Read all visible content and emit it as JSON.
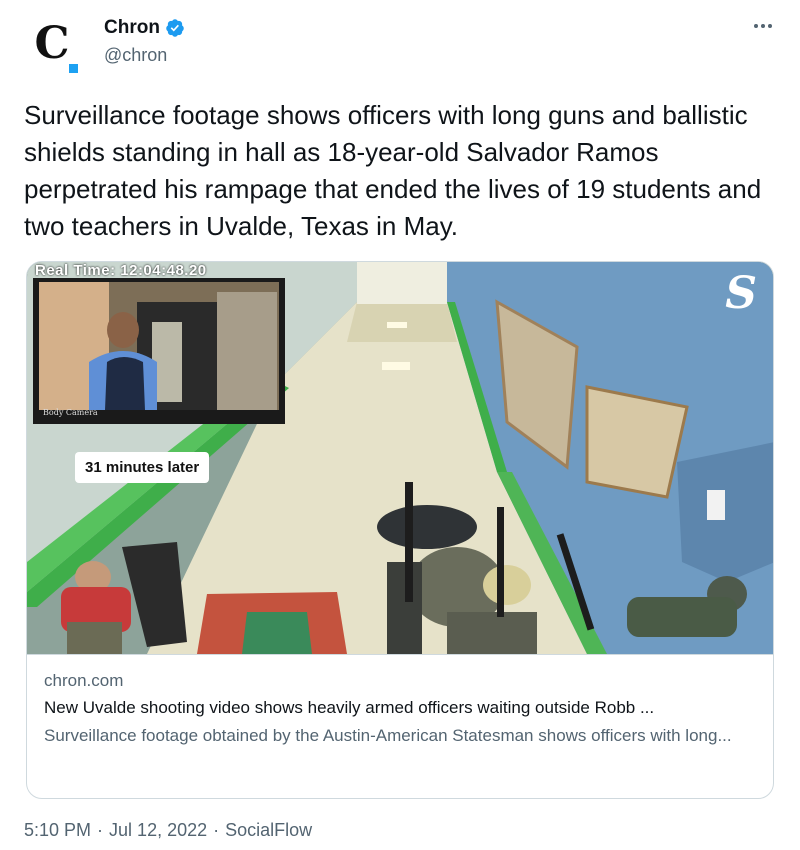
{
  "author": {
    "display_name": "Chron",
    "handle": "@chron",
    "avatar_logo": "C",
    "verified": true
  },
  "tweet": {
    "text": "Surveillance footage shows officers with long guns and ballistic shields standing in hall as 18-year-old Salvador Ramos perpetrated his rampage that ended the lives of 19 students and two teachers in Uvalde, Texas in May."
  },
  "card": {
    "media": {
      "overlay_time": "Real Time: 12:04:48.20",
      "caption": "31 minutes later",
      "inset_label": "Body Camera",
      "brand_mark": "S"
    },
    "domain": "chron.com",
    "title": "New Uvalde shooting video shows heavily armed officers waiting outside Robb ...",
    "description": "Surveillance footage obtained by the Austin-American Statesman shows officers with long..."
  },
  "meta": {
    "time": "5:10 PM",
    "date": "Jul 12, 2022",
    "separator": "·",
    "source": "SocialFlow"
  },
  "icons": {
    "verified": "verified-badge-icon",
    "more": "more-options-icon"
  },
  "colors": {
    "accent": "#1d9bf0",
    "text_primary": "#0f1419",
    "text_secondary": "#536471",
    "border": "#cfd9de"
  }
}
